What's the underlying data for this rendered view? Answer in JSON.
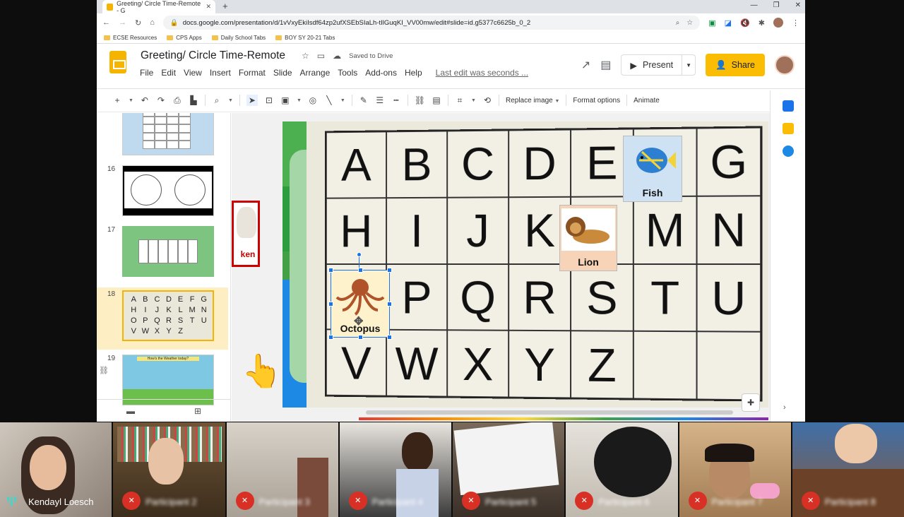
{
  "browser": {
    "tab_title": "Greeting/ Circle Time-Remote - G",
    "url": "docs.google.com/presentation/d/1vVxyEkiIsdf64zp2ufXSEbSIaLh-tIlGuqKI_VV00mw/edit#slide=id.g5377c6625b_0_2",
    "bookmarks": [
      "ECSE Resources",
      "CPS Apps",
      "Daily School Tabs",
      "BOY SY 20-21 Tabs"
    ]
  },
  "app": {
    "title": "Greeting/ Circle Time-Remote",
    "saved_status": "Saved to Drive",
    "menu": [
      "File",
      "Edit",
      "View",
      "Insert",
      "Format",
      "Slide",
      "Arrange",
      "Tools",
      "Add-ons",
      "Help"
    ],
    "last_edit": "Last edit was seconds ...",
    "present_label": "Present",
    "share_label": "Share",
    "toolbar_text": {
      "replace_image": "Replace image",
      "format_options": "Format options",
      "animate": "Animate"
    }
  },
  "filmstrip": {
    "slides": [
      {
        "number": "",
        "active": false
      },
      {
        "number": "16",
        "active": false
      },
      {
        "number": "17",
        "active": false
      },
      {
        "number": "18",
        "active": true
      },
      {
        "number": "19",
        "active": false
      }
    ],
    "slide19_caption": "How's the Weather today?"
  },
  "slide": {
    "letters": [
      "A",
      "B",
      "C",
      "D",
      "E",
      "F",
      "G",
      "H",
      "I",
      "J",
      "K",
      "L",
      "M",
      "N",
      "O",
      "P",
      "Q",
      "R",
      "S",
      "T",
      "U",
      "V",
      "W",
      "X",
      "Y",
      "Z",
      "",
      ""
    ],
    "cards": [
      {
        "label": "Fish",
        "icon": "fish-icon",
        "color": "#cfe2f3"
      },
      {
        "label": "Lion",
        "icon": "lion-icon",
        "color": "#f7d4b8"
      },
      {
        "label": "Octopus",
        "icon": "octopus-icon",
        "color": "#fdf2cc"
      }
    ],
    "partial_card_label": "ken",
    "stripe_colors": [
      "#4caf50",
      "#1e88e5"
    ]
  },
  "meet": {
    "participants": [
      {
        "name": "Kendayl Loesch",
        "muted": false
      },
      {
        "name": "Participant 2",
        "muted": true
      },
      {
        "name": "Participant 3",
        "muted": true
      },
      {
        "name": "Participant 4",
        "muted": true
      },
      {
        "name": "Participant 5",
        "muted": true
      },
      {
        "name": "Participant 6",
        "muted": true
      },
      {
        "name": "Participant 7",
        "muted": true
      },
      {
        "name": "Participant 8",
        "muted": true
      }
    ]
  }
}
